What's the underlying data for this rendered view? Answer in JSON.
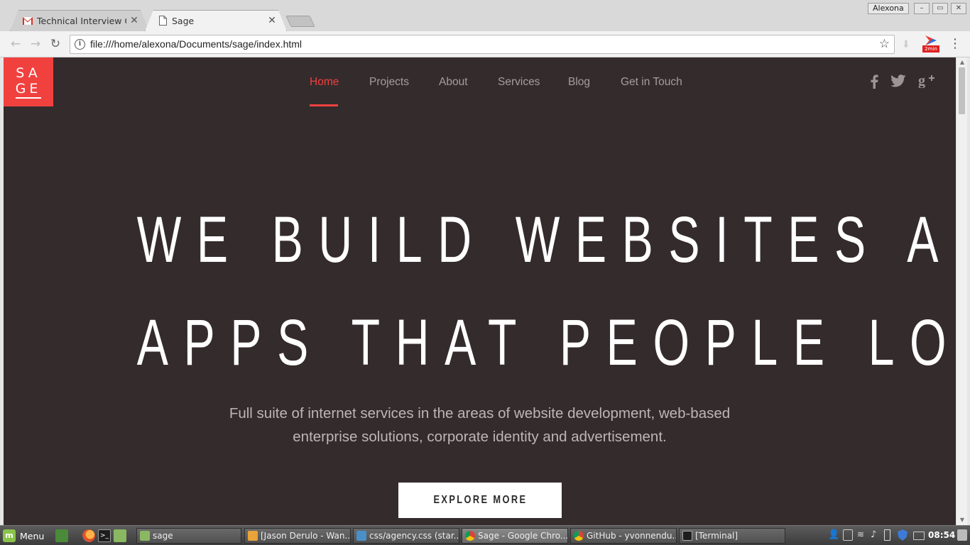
{
  "browser": {
    "profile_name": "Alexona",
    "tabs": [
      {
        "title": "Technical Interview Que",
        "icon": "gmail-icon",
        "active": false
      },
      {
        "title": "Sage",
        "icon": "page-icon",
        "active": true
      }
    ],
    "address": "file:///home/alexona/Documents/sage/index.html",
    "extension_badge": "2min",
    "window_controls": {
      "minimize": "–",
      "maximize": "▭",
      "close": "✕"
    }
  },
  "site": {
    "logo": {
      "line1": "SA",
      "line2": "GE"
    },
    "nav": [
      {
        "label": "Home",
        "active": true
      },
      {
        "label": "Projects",
        "active": false
      },
      {
        "label": "About",
        "active": false
      },
      {
        "label": "Services",
        "active": false
      },
      {
        "label": "Blog",
        "active": false
      },
      {
        "label": "Get in Touch",
        "active": false
      }
    ],
    "social": [
      {
        "icon": "facebook-icon",
        "glyph": "f"
      },
      {
        "icon": "twitter-icon",
        "glyph": "🐦"
      },
      {
        "icon": "google-plus-icon",
        "glyph": "g+"
      }
    ],
    "hero": {
      "line1": "WE BUILD WEBSITES AND",
      "line2": "APPS THAT PEOPLE LOVE",
      "subtitle_line1": "Full suite of internet services in the areas of website development, web-based",
      "subtitle_line2": "enterprise solutions, corporate identity and advertisement.",
      "cta": "EXPLORE MORE"
    },
    "colors": {
      "accent": "#f0413f",
      "background": "#342b2d"
    }
  },
  "taskbar": {
    "menu_label": "Menu",
    "tasks": [
      {
        "label": "sage",
        "icon": "folder-icon",
        "active": false
      },
      {
        "label": "[Jason Derulo - Wan...",
        "icon": "media-player-icon",
        "active": false
      },
      {
        "label": "css/agency.css (star...",
        "icon": "editor-icon",
        "active": false
      },
      {
        "label": "Sage - Google Chro...",
        "icon": "chrome-icon",
        "active": true
      },
      {
        "label": "GitHub - yvonnendu...",
        "icon": "chrome-icon",
        "active": false
      },
      {
        "label": "[Terminal]",
        "icon": "terminal-icon",
        "active": false
      }
    ],
    "clock": "08:54"
  }
}
